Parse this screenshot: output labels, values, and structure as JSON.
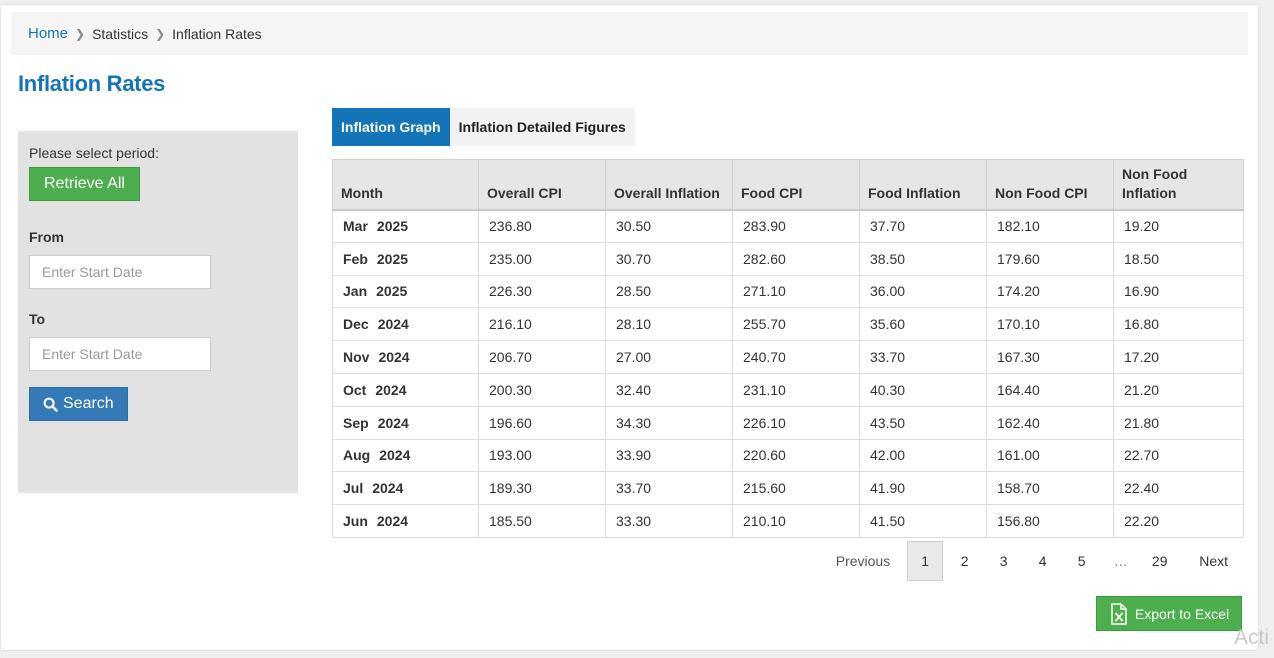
{
  "breadcrumb": {
    "home": "Home",
    "section": "Statistics",
    "current": "Inflation Rates"
  },
  "page_title": "Inflation Rates",
  "sidebar": {
    "prompt": "Please select period:",
    "retrieve_all": "Retrieve All",
    "from_label": "From",
    "from_placeholder": "Enter Start Date",
    "to_label": "To",
    "to_placeholder": "Enter Start Date",
    "search_label": "Search"
  },
  "tabs": [
    {
      "label": "Inflation Graph",
      "active": true
    },
    {
      "label": "Inflation Detailed Figures",
      "active": false
    }
  ],
  "table": {
    "headers": [
      "Month",
      "Overall CPI",
      "Overall Inflation",
      "Food CPI",
      "Food Inflation",
      "Non Food CPI",
      "Non Food Inflation"
    ],
    "rows": [
      {
        "month": "Mar",
        "year": "2025",
        "overall_cpi": "236.80",
        "overall_inflation": "30.50",
        "food_cpi": "283.90",
        "food_inflation": "37.70",
        "nonfood_cpi": "182.10",
        "nonfood_inflation": "19.20"
      },
      {
        "month": "Feb",
        "year": "2025",
        "overall_cpi": "235.00",
        "overall_inflation": "30.70",
        "food_cpi": "282.60",
        "food_inflation": "38.50",
        "nonfood_cpi": "179.60",
        "nonfood_inflation": "18.50"
      },
      {
        "month": "Jan",
        "year": "2025",
        "overall_cpi": "226.30",
        "overall_inflation": "28.50",
        "food_cpi": "271.10",
        "food_inflation": "36.00",
        "nonfood_cpi": "174.20",
        "nonfood_inflation": "16.90"
      },
      {
        "month": "Dec",
        "year": "2024",
        "overall_cpi": "216.10",
        "overall_inflation": "28.10",
        "food_cpi": "255.70",
        "food_inflation": "35.60",
        "nonfood_cpi": "170.10",
        "nonfood_inflation": "16.80"
      },
      {
        "month": "Nov",
        "year": "2024",
        "overall_cpi": "206.70",
        "overall_inflation": "27.00",
        "food_cpi": "240.70",
        "food_inflation": "33.70",
        "nonfood_cpi": "167.30",
        "nonfood_inflation": "17.20"
      },
      {
        "month": "Oct",
        "year": "2024",
        "overall_cpi": "200.30",
        "overall_inflation": "32.40",
        "food_cpi": "231.10",
        "food_inflation": "40.30",
        "nonfood_cpi": "164.40",
        "nonfood_inflation": "21.20"
      },
      {
        "month": "Sep",
        "year": "2024",
        "overall_cpi": "196.60",
        "overall_inflation": "34.30",
        "food_cpi": "226.10",
        "food_inflation": "43.50",
        "nonfood_cpi": "162.40",
        "nonfood_inflation": "21.80"
      },
      {
        "month": "Aug",
        "year": "2024",
        "overall_cpi": "193.00",
        "overall_inflation": "33.90",
        "food_cpi": "220.60",
        "food_inflation": "42.00",
        "nonfood_cpi": "161.00",
        "nonfood_inflation": "22.70"
      },
      {
        "month": "Jul",
        "year": "2024",
        "overall_cpi": "189.30",
        "overall_inflation": "33.70",
        "food_cpi": "215.60",
        "food_inflation": "41.90",
        "nonfood_cpi": "158.70",
        "nonfood_inflation": "22.40"
      },
      {
        "month": "Jun",
        "year": "2024",
        "overall_cpi": "185.50",
        "overall_inflation": "33.30",
        "food_cpi": "210.10",
        "food_inflation": "41.50",
        "nonfood_cpi": "156.80",
        "nonfood_inflation": "22.20"
      }
    ]
  },
  "pagination": {
    "previous": "Previous",
    "pages": [
      "1",
      "2",
      "3",
      "4",
      "5"
    ],
    "ellipsis": "…",
    "last": "29",
    "next": "Next",
    "current": "1"
  },
  "export_label": "Export to Excel",
  "watermark": "Acti",
  "colors": {
    "accent": "#1474b8",
    "green": "#4cae4c",
    "search_blue": "#337ab7"
  }
}
